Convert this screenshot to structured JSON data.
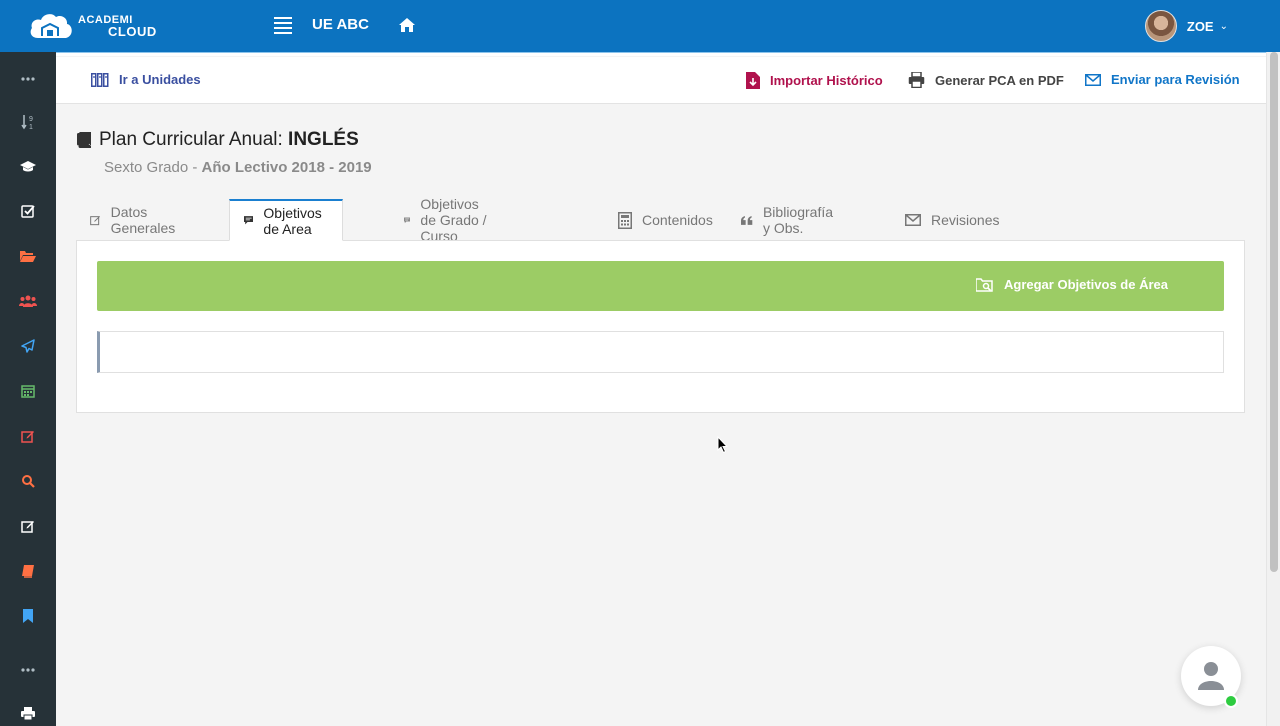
{
  "brand": {
    "line1": "ACADEMI",
    "line2": "CLOUD"
  },
  "header": {
    "school": "UE ABC",
    "user": "ZOE"
  },
  "sidebar": {
    "items": [
      {
        "icon": "more-icon",
        "color": "#b0bec5"
      },
      {
        "icon": "sort-numeric-icon",
        "color": "#b0bec5"
      },
      {
        "icon": "graduation-cap-icon",
        "color": "#ffffff"
      },
      {
        "icon": "checkbox-icon",
        "color": "#ffffff"
      },
      {
        "icon": "folder-open-icon",
        "color": "#ff7043"
      },
      {
        "icon": "users-icon",
        "color": "#ef5350"
      },
      {
        "icon": "paper-plane-icon",
        "color": "#42a5f5"
      },
      {
        "icon": "calendar-icon",
        "color": "#66bb6a"
      },
      {
        "icon": "edit-icon",
        "color": "#ef5350"
      },
      {
        "icon": "search-icon",
        "color": "#ff7043"
      },
      {
        "icon": "edit-alt-icon",
        "color": "#ffffff"
      },
      {
        "icon": "book-icon",
        "color": "#ff7043"
      },
      {
        "icon": "bookmark-icon",
        "color": "#42a5f5"
      },
      {
        "icon": "more-icon",
        "color": "#b0bec5"
      },
      {
        "icon": "print-icon",
        "color": "#ffffff"
      }
    ]
  },
  "actions": {
    "units": "Ir a Unidades",
    "import": "Importar Histórico",
    "pdf": "Generar PCA en PDF",
    "send": "Enviar para Revisión"
  },
  "title": {
    "prefix": "Plan Curricular Anual: ",
    "subject": "INGLÉS",
    "grade": "Sexto Grado - ",
    "year": "Año Lectivo 2018 - 2019"
  },
  "tabs": [
    {
      "label": "Datos Generales",
      "active": false
    },
    {
      "label": "Objetivos de Area",
      "active": true
    },
    {
      "label": "Objetivos de Grado / Curso",
      "active": false
    },
    {
      "label": "Contenidos",
      "active": false
    },
    {
      "label": "Bibliografía y Obs.",
      "active": false
    },
    {
      "label": "Revisiones",
      "active": false
    }
  ],
  "panel": {
    "add_label": "Agregar Objetivos de Área"
  },
  "colors": {
    "topbar": "#0c73c0",
    "sidebar": "#263238",
    "green": "#9ccc65",
    "accent": "#1a7fd0"
  }
}
